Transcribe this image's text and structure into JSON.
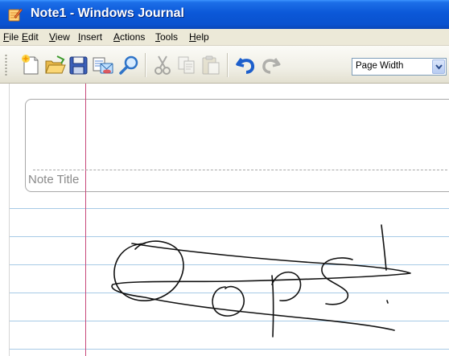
{
  "window": {
    "title": "Note1 - Windows Journal",
    "app_icon": "journal-pen-icon"
  },
  "menu": {
    "items": [
      {
        "key": "F",
        "rest": "ile"
      },
      {
        "key": "E",
        "rest": "dit"
      },
      {
        "key": "V",
        "rest": "iew"
      },
      {
        "key": "I",
        "rest": "nsert"
      },
      {
        "key": "A",
        "rest": "ctions"
      },
      {
        "key": "T",
        "rest": "ools"
      },
      {
        "key": "H",
        "rest": "elp"
      }
    ]
  },
  "toolbar": {
    "buttons": [
      "new-note-icon",
      "open-folder-icon",
      "save-disk-icon",
      "send-email-icon",
      "find-magnifier-icon",
      "cut-scissors-icon",
      "copy-icon",
      "paste-icon",
      "undo-icon",
      "redo-icon"
    ],
    "zoom": {
      "value": "Page Width"
    }
  },
  "note": {
    "title_placeholder": "Note Title",
    "ink_text": "Oops!"
  },
  "colors": {
    "titlebar": "#0a52cf",
    "menubar": "#ece9d8",
    "margin_line": "#c84a7a",
    "rule_line": "#a7cae6",
    "ink": "#000000"
  }
}
